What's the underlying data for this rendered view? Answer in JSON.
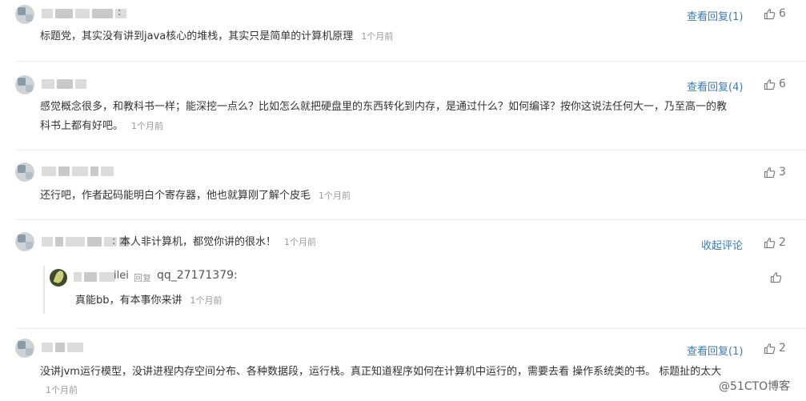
{
  "comments": [
    {
      "text": "标题党，其实没有讲到java核心的堆栈，其实只是简单的计算机原理",
      "time": "1个月前",
      "reply_link": "查看回复(1)",
      "likes": "6"
    },
    {
      "text_line1": "感觉概念很多，和教科书一样；能深挖一点么？比如怎么就把硬盘里的东西转化到内存，是通过什么？如何编译？按你这说法任何大一，乃至高一的教",
      "text_line2": "科书上都有好吧。",
      "time": "1个月前",
      "reply_link": "查看回复(4)",
      "likes": "6"
    },
    {
      "text": "还行吧，作者起码能明白个寄存器，他也就算刚了解个皮毛",
      "time": "1个月前",
      "likes": "3"
    },
    {
      "text": "本人非计算机，都觉你讲的很水！",
      "time": "1个月前",
      "reply_link": "收起评论",
      "likes": "2",
      "sub_reply": {
        "name_suffix": "ilei",
        "reply_word": "回复",
        "reply_target": "qq_27171379:",
        "text": "真能bb，有本事你来讲",
        "time": "1个月前"
      }
    },
    {
      "text_line1": "没讲jvm运行模型，没讲进程内存空间分布、各种数据段，运行栈。真正知道程序如何在计算机中运行的，需要去看 操作系统类的书。 标题扯的太大",
      "time": "1个月前",
      "reply_link": "查看回复(1)",
      "likes": "2"
    }
  ],
  "watermark": "@51CTO博客",
  "icons": {
    "like": "thumbs-up-icon"
  },
  "colors": {
    "link": "#3c7cb0",
    "time": "#999999",
    "divider": "#ececec"
  }
}
